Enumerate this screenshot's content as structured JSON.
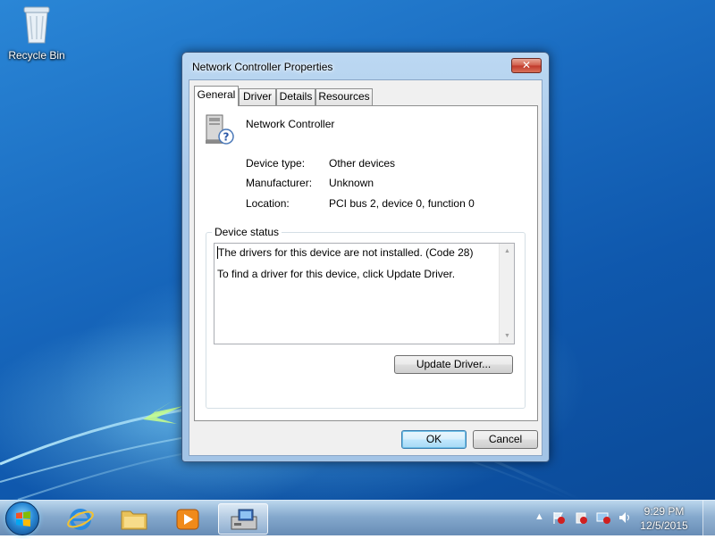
{
  "desktop": {
    "icons": [
      {
        "label": "Recycle Bin",
        "icon": "recycle-bin-icon"
      }
    ]
  },
  "dialog": {
    "title": "Network Controller Properties",
    "close_label": "✕",
    "tabs": [
      {
        "label": "General",
        "active": true
      },
      {
        "label": "Driver",
        "active": false
      },
      {
        "label": "Details",
        "active": false
      },
      {
        "label": "Resources",
        "active": false
      }
    ],
    "device_name": "Network Controller",
    "properties": [
      {
        "label": "Device type:",
        "value": "Other devices"
      },
      {
        "label": "Manufacturer:",
        "value": "Unknown"
      },
      {
        "label": "Location:",
        "value": "PCI bus 2, device 0, function 0"
      }
    ],
    "status_group_label": "Device status",
    "status_lines": [
      "The drivers for this device are not installed. (Code 28)",
      "To find a driver for this device, click Update Driver."
    ],
    "update_driver_label": "Update Driver...",
    "ok_label": "OK",
    "cancel_label": "Cancel"
  },
  "taskbar": {
    "items": [
      "internet-explorer-icon",
      "file-explorer-icon",
      "media-player-icon",
      "device-manager-icon"
    ],
    "active_item": "device-manager-icon",
    "clock": {
      "time": "9:29 PM",
      "date": "12/5/2015"
    }
  },
  "colors": {
    "desktop_blue": "#1a6cc1",
    "dialog_frame": "#a9c9ea",
    "close_red": "#c0392b",
    "default_button": "#bee6fd"
  }
}
